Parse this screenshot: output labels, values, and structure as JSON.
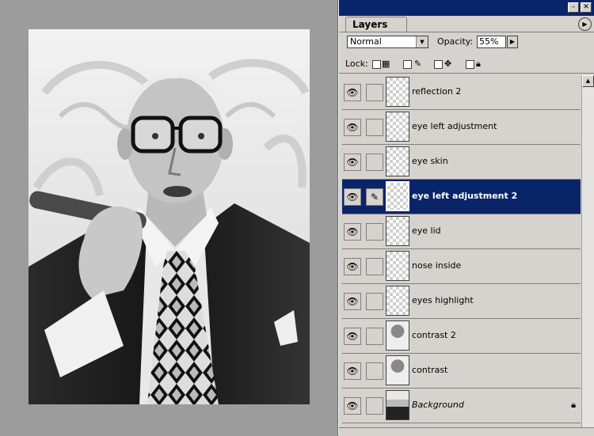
{
  "panel": {
    "tab_label": "Layers",
    "blend_mode": "Normal",
    "opacity_label": "Opacity:",
    "opacity_value": "55%",
    "lock_label": "Lock:",
    "colors": {
      "titlebar": "#0a246a",
      "selected": "#0a246a",
      "panel": "#d6d3ce"
    }
  },
  "layers": [
    {
      "name": "reflection 2",
      "visible": true,
      "selected": false,
      "thumb": "transparent"
    },
    {
      "name": "eye left adjustment",
      "visible": true,
      "selected": false,
      "thumb": "transparent"
    },
    {
      "name": "eye skin",
      "visible": true,
      "selected": false,
      "thumb": "transparent"
    },
    {
      "name": "eye left adjustment 2",
      "visible": true,
      "selected": true,
      "thumb": "transparent"
    },
    {
      "name": "eye lid",
      "visible": true,
      "selected": false,
      "thumb": "transparent"
    },
    {
      "name": "nose inside",
      "visible": true,
      "selected": false,
      "thumb": "transparent"
    },
    {
      "name": "eyes highlight",
      "visible": true,
      "selected": false,
      "thumb": "transparent"
    },
    {
      "name": "contrast 2",
      "visible": true,
      "selected": false,
      "thumb": "image"
    },
    {
      "name": "contrast",
      "visible": true,
      "selected": false,
      "thumb": "image"
    },
    {
      "name": "Background",
      "visible": true,
      "selected": false,
      "thumb": "image",
      "locked": true
    }
  ],
  "icons": {
    "eye": "eye-icon",
    "brush": "brush-icon",
    "lock": "lock-icon"
  }
}
